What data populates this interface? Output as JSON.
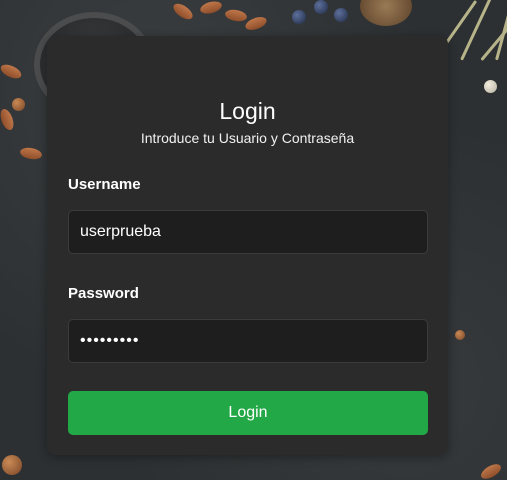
{
  "login_card": {
    "title": "Login",
    "subtitle": "Introduce tu Usuario y Contraseña",
    "username_label": "Username",
    "username_value": "userprueba",
    "password_label": "Password",
    "password_value": "•••••••••",
    "submit_label": "Login"
  },
  "colors": {
    "card_background": "#2b2b2b",
    "input_background": "#1e1e1e",
    "button_green": "#23a847",
    "text": "#ffffff"
  }
}
